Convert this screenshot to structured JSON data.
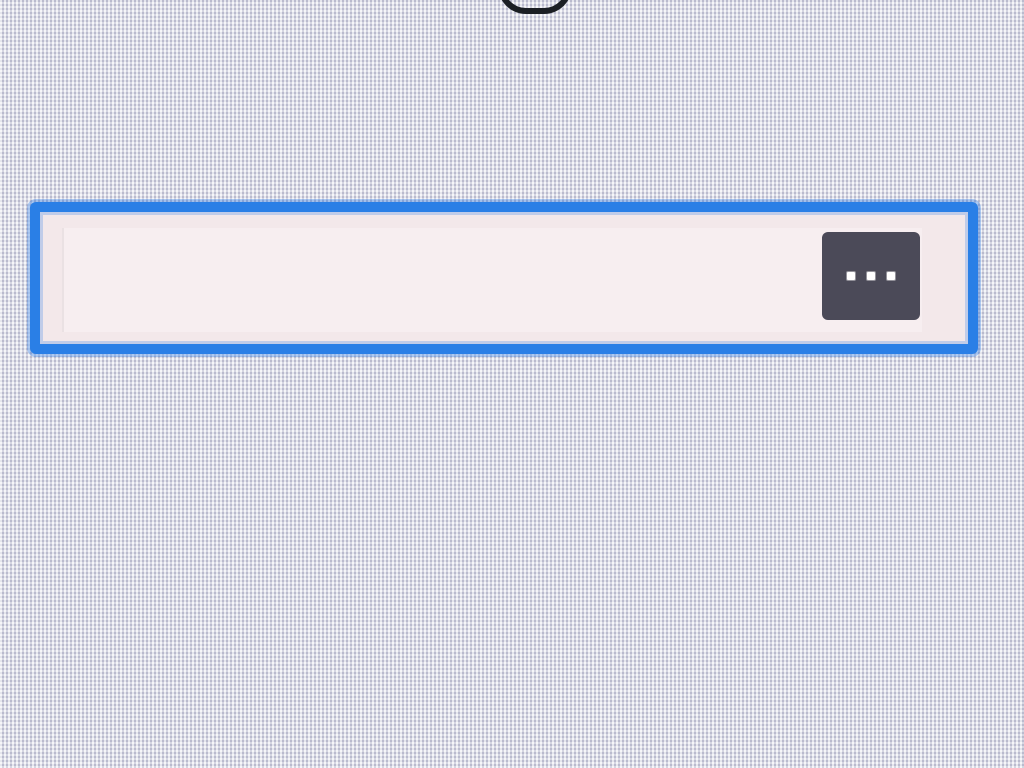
{
  "search": {
    "value": "",
    "placeholder": ""
  },
  "more_button": {
    "icon": "more-icon"
  },
  "colors": {
    "focus_ring": "#2a7fe6",
    "field_bg": "#f7eef0",
    "button_bg": "#4b4a58",
    "cursor": "#1b1b1b"
  }
}
